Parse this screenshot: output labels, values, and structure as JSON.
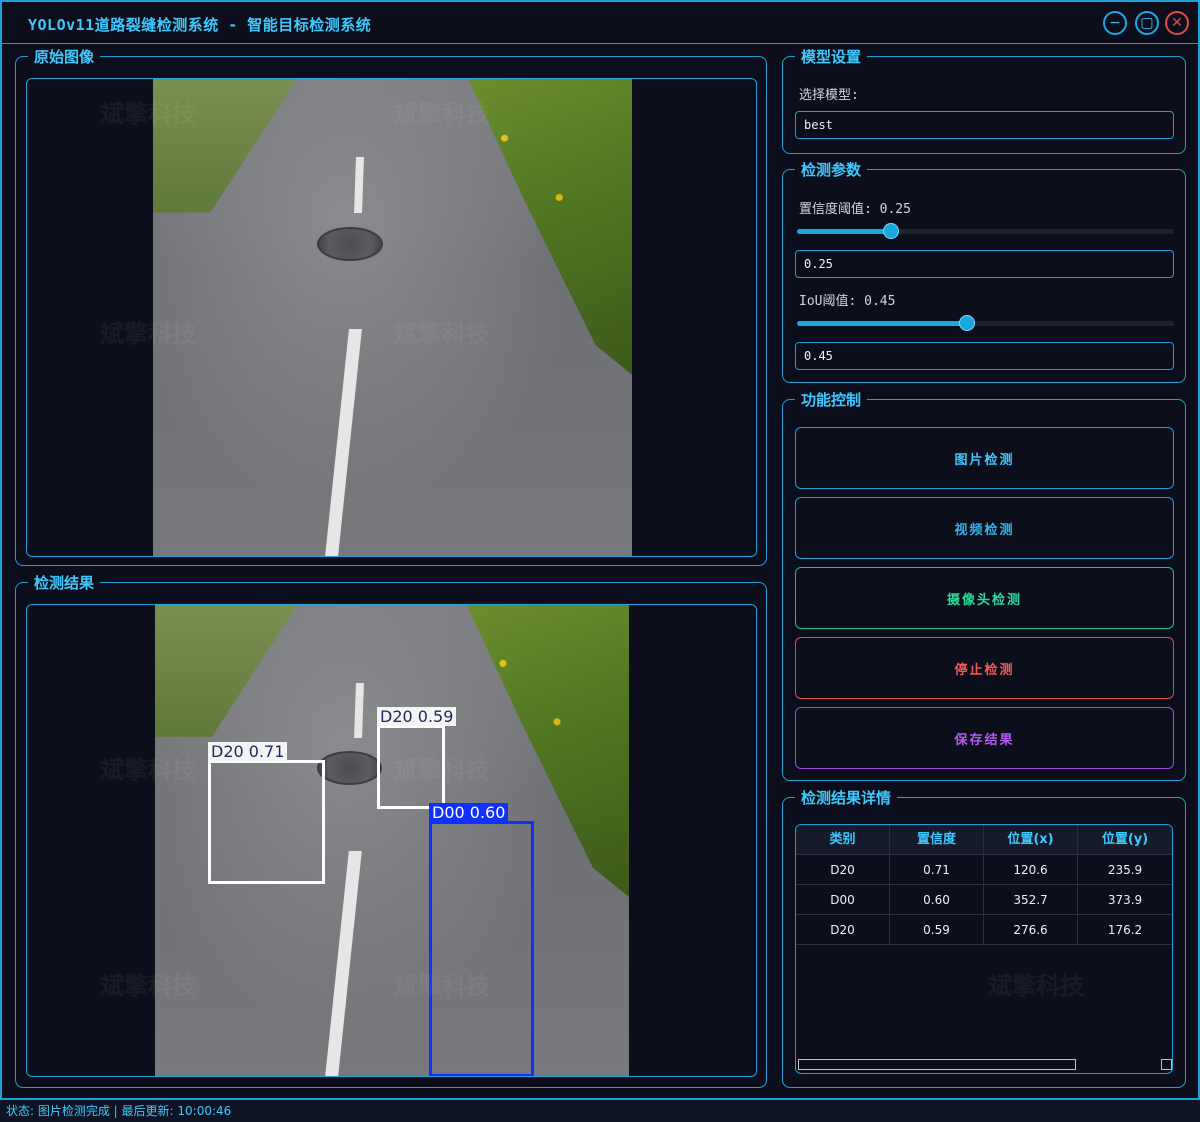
{
  "window": {
    "title": "YOLOv11道路裂缝检测系统 - 智能目标检测系统",
    "min_glyph": "−",
    "max_glyph": "▢",
    "close_glyph": "✕"
  },
  "panels": {
    "original_title": "原始图像",
    "result_title": "检测结果"
  },
  "detections_overlay": [
    {
      "label": "D20  0.71",
      "color": "#ffffff"
    },
    {
      "label": "D20  0.59",
      "color": "#ffffff"
    },
    {
      "label": "D00  0.60",
      "color": "#1030ff"
    }
  ],
  "model_settings": {
    "title": "模型设置",
    "select_label": "选择模型:",
    "model_value": "best"
  },
  "params": {
    "title": "检测参数",
    "conf_label": "置信度阈值: 0.25",
    "conf_value": "0.25",
    "conf_fraction": 0.25,
    "iou_label": "IoU阈值: 0.45",
    "iou_value": "0.45",
    "iou_fraction": 0.45
  },
  "controls": {
    "title": "功能控制",
    "image_detect": "图片检测",
    "video_detect": "视频检测",
    "camera_detect": "摄像头检测",
    "stop_detect": "停止检测",
    "save_result": "保存结果"
  },
  "results": {
    "title": "检测结果详情",
    "columns": [
      "类别",
      "置信度",
      "位置(x)",
      "位置(y)"
    ],
    "rows": [
      [
        "D20",
        "0.71",
        "120.6",
        "235.9"
      ],
      [
        "D00",
        "0.60",
        "352.7",
        "373.9"
      ],
      [
        "D20",
        "0.59",
        "276.6",
        "176.2"
      ]
    ]
  },
  "status": {
    "text": "状态: 图片检测完成 | 最后更新: 10:00:46"
  },
  "watermark_text": "斌擎科技",
  "colors": {
    "accent": "#1ea0d8",
    "image_btn": "#1ea0d8",
    "video_btn": "#1ea0d8",
    "camera_btn": "#1fbf8a",
    "stop_btn": "#e04a4a",
    "save_btn": "#a04ae0"
  }
}
